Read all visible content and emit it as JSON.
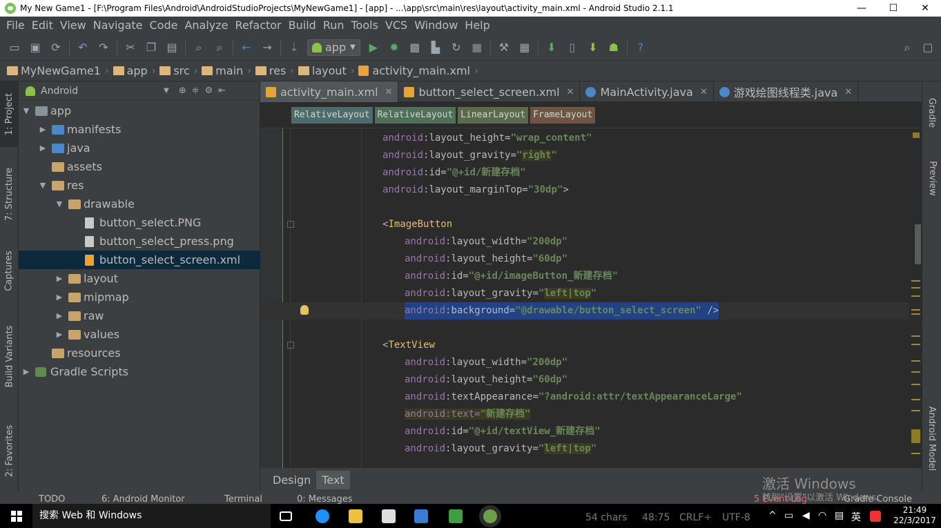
{
  "window": {
    "title": "My New Game1 - [F:\\Program Files\\Android\\AndroidStudioProjects\\MyNewGame1] - [app] - ...\\app\\src\\main\\res\\layout\\activity_main.xml - Android Studio 2.1.1",
    "minimize": "—",
    "maximize": "☐",
    "close": "✕"
  },
  "menu": [
    "File",
    "Edit",
    "View",
    "Navigate",
    "Code",
    "Analyze",
    "Refactor",
    "Build",
    "Run",
    "Tools",
    "VCS",
    "Window",
    "Help"
  ],
  "toolbar": {
    "run_config": "app",
    "help": "?"
  },
  "breadcrumb": [
    "MyNewGame1",
    "app",
    "src",
    "main",
    "res",
    "layout",
    "activity_main.xml"
  ],
  "left_tabs": [
    "1: Project",
    "7: Structure",
    "Captures",
    "Build Variants",
    "2: Favorites"
  ],
  "right_tabs": [
    "Gradle",
    "Preview",
    "Android Model"
  ],
  "project": {
    "view": "Android",
    "tree": [
      {
        "label": "app",
        "depth": 0,
        "arrow": "▼",
        "icon": "app"
      },
      {
        "label": "manifests",
        "depth": 1,
        "arrow": "▶",
        "icon": "blue"
      },
      {
        "label": "java",
        "depth": 1,
        "arrow": "▶",
        "icon": "blue"
      },
      {
        "label": "assets",
        "depth": 1,
        "arrow": "",
        "icon": "res"
      },
      {
        "label": "res",
        "depth": 1,
        "arrow": "▼",
        "icon": "res"
      },
      {
        "label": "drawable",
        "depth": 2,
        "arrow": "▼",
        "icon": "res"
      },
      {
        "label": "button_select.PNG",
        "depth": 3,
        "arrow": "",
        "icon": "file"
      },
      {
        "label": "button_select_press.png",
        "depth": 3,
        "arrow": "",
        "icon": "file"
      },
      {
        "label": "button_select_screen.xml",
        "depth": 3,
        "arrow": "",
        "icon": "xml",
        "selected": true
      },
      {
        "label": "layout",
        "depth": 2,
        "arrow": "▶",
        "icon": "res"
      },
      {
        "label": "mipmap",
        "depth": 2,
        "arrow": "▶",
        "icon": "res"
      },
      {
        "label": "raw",
        "depth": 2,
        "arrow": "▶",
        "icon": "res"
      },
      {
        "label": "values",
        "depth": 2,
        "arrow": "▶",
        "icon": "res"
      },
      {
        "label": "resources",
        "depth": 1,
        "arrow": "",
        "icon": "res"
      },
      {
        "label": "Gradle Scripts",
        "depth": 0,
        "arrow": "▶",
        "icon": "gradle"
      }
    ]
  },
  "editor_tabs": [
    {
      "label": "activity_main.xml",
      "icon": "xml",
      "active": true
    },
    {
      "label": "button_select_screen.xml",
      "icon": "xml",
      "active": false
    },
    {
      "label": "MainActivity.java",
      "icon": "c",
      "active": false
    },
    {
      "label": "游戏绘图线程类.java",
      "icon": "c",
      "active": false
    }
  ],
  "tag_breadcrumb": [
    "RelativeLayout",
    "RelativeLayout",
    "LinearLayout",
    "FrameLayout"
  ],
  "code_lines": [
    {
      "indent": 6,
      "parts": [
        [
          "an",
          "android"
        ],
        [
          "at",
          ":layout_height="
        ],
        [
          "val",
          "\"wrap_content\""
        ]
      ]
    },
    {
      "indent": 6,
      "parts": [
        [
          "an",
          "android"
        ],
        [
          "at",
          ":layout_gravity="
        ],
        [
          "val",
          "\""
        ],
        [
          "valw",
          "right"
        ],
        [
          "val",
          "\""
        ]
      ]
    },
    {
      "indent": 6,
      "parts": [
        [
          "an",
          "android"
        ],
        [
          "at",
          ":id="
        ],
        [
          "val",
          "\"@+id/新建存档\""
        ]
      ]
    },
    {
      "indent": 6,
      "parts": [
        [
          "an",
          "android"
        ],
        [
          "at",
          ":layout_marginTop="
        ],
        [
          "val",
          "\"30dp\""
        ],
        [
          "at",
          ">"
        ]
      ]
    },
    {
      "indent": 0,
      "parts": []
    },
    {
      "indent": 6,
      "parts": [
        [
          "at",
          "<"
        ],
        [
          "tag",
          "ImageButton"
        ]
      ],
      "fold": true
    },
    {
      "indent": 10,
      "parts": [
        [
          "an",
          "android"
        ],
        [
          "at",
          ":layout_width="
        ],
        [
          "val",
          "\"200dp\""
        ]
      ]
    },
    {
      "indent": 10,
      "parts": [
        [
          "an",
          "android"
        ],
        [
          "at",
          ":layout_height="
        ],
        [
          "val",
          "\"60dp\""
        ]
      ]
    },
    {
      "indent": 10,
      "parts": [
        [
          "an",
          "android"
        ],
        [
          "at",
          ":id="
        ],
        [
          "val",
          "\"@+id/imageButton_新建存档\""
        ]
      ]
    },
    {
      "indent": 10,
      "parts": [
        [
          "an",
          "android"
        ],
        [
          "at",
          ":layout_gravity="
        ],
        [
          "val",
          "\""
        ],
        [
          "valw",
          "left|top"
        ],
        [
          "val",
          "\""
        ]
      ]
    },
    {
      "indent": 10,
      "parts": [
        [
          "an",
          "android"
        ],
        [
          "at",
          ":background="
        ],
        [
          "val",
          "\"@drawable/button_select_screen\""
        ],
        [
          "at",
          " />"
        ]
      ],
      "selected": true,
      "bulb": true
    },
    {
      "indent": 0,
      "parts": []
    },
    {
      "indent": 6,
      "parts": [
        [
          "at",
          "<"
        ],
        [
          "tag",
          "TextView"
        ]
      ],
      "fold": true
    },
    {
      "indent": 10,
      "parts": [
        [
          "an",
          "android"
        ],
        [
          "at",
          ":layout_width="
        ],
        [
          "val",
          "\"200dp\""
        ]
      ]
    },
    {
      "indent": 10,
      "parts": [
        [
          "an",
          "android"
        ],
        [
          "at",
          ":layout_height="
        ],
        [
          "val",
          "\"60dp\""
        ]
      ]
    },
    {
      "indent": 10,
      "parts": [
        [
          "an",
          "android"
        ],
        [
          "at",
          ":textAppearance="
        ],
        [
          "val",
          "\"?android:attr/textAppearanceLarge\""
        ]
      ]
    },
    {
      "indent": 10,
      "parts": [
        [
          "anw",
          "android:text="
        ],
        [
          "valw",
          "\"新建存档\""
        ]
      ]
    },
    {
      "indent": 10,
      "parts": [
        [
          "an",
          "android"
        ],
        [
          "at",
          ":id="
        ],
        [
          "val",
          "\"@+id/textView_新建存档\""
        ]
      ]
    },
    {
      "indent": 10,
      "parts": [
        [
          "an",
          "android"
        ],
        [
          "at",
          ":layout_gravity="
        ],
        [
          "val",
          "\""
        ],
        [
          "valw",
          "left|top"
        ],
        [
          "val",
          "\""
        ]
      ]
    }
  ],
  "design_tabs": [
    "Design",
    "Text"
  ],
  "bottom_tabs": [
    "TODO",
    "6: Android Monitor",
    "Terminal",
    "0: Messages",
    "5 Event Log",
    "Gradle Console"
  ],
  "status": {
    "chars": "54 chars",
    "pos": "48:75",
    "crlf": "CRLF÷",
    "enc": "UTF-8"
  },
  "activation": {
    "line1": "激活 Windows",
    "line2": "转到\"设置\"以激活 Windows。"
  },
  "taskbar": {
    "search": "搜索 Web 和 Windows",
    "ime": "英",
    "time": "21:49",
    "date": "22/3/2017"
  },
  "colors": {
    "accent": "#214283",
    "selected": "#0d293e"
  }
}
